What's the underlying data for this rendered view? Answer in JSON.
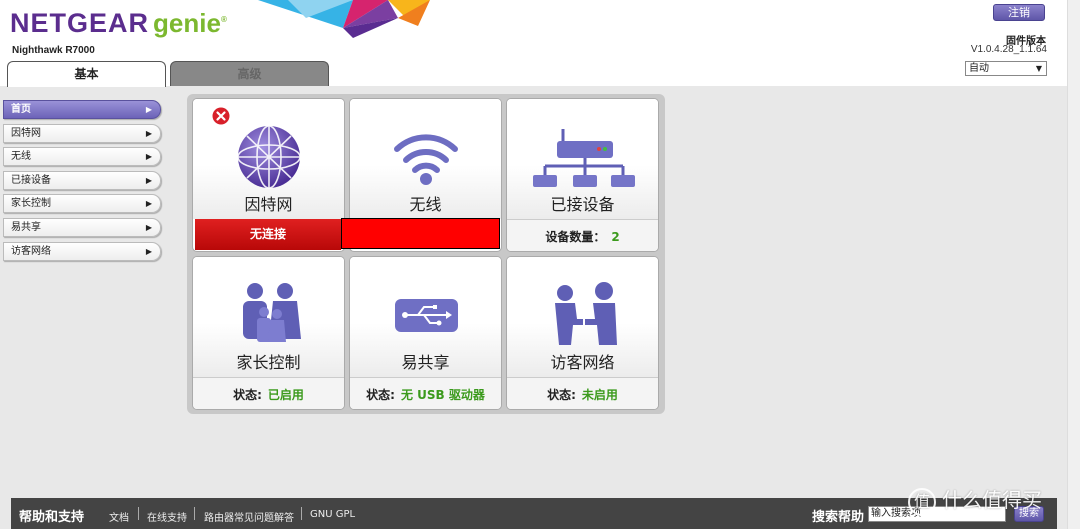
{
  "header": {
    "logo_brand": "NETGEAR",
    "logo_product": "genie",
    "logo_trademark": "®",
    "model": "Nighthawk R7000",
    "logout_label": "注销",
    "firmware_label": "固件版本",
    "firmware_version": "V1.0.4.28_1.1.64",
    "language_selected": "自动"
  },
  "tabs": [
    {
      "label": "基本",
      "active": true
    },
    {
      "label": "高级",
      "active": false
    }
  ],
  "sidebar": {
    "items": [
      {
        "label": "首页",
        "active": true
      },
      {
        "label": "因特网"
      },
      {
        "label": "无线"
      },
      {
        "label": "已接设备"
      },
      {
        "label": "家长控制"
      },
      {
        "label": "易共享"
      },
      {
        "label": "访客网络"
      }
    ],
    "arrow_glyph": "▶"
  },
  "tiles": {
    "internet": {
      "name": "因特网",
      "status": "无连接"
    },
    "wireless": {
      "name": "无线"
    },
    "devices": {
      "name": "已接设备",
      "status_label": "设备数量：",
      "status_value": "2"
    },
    "parental": {
      "name": "家长控制",
      "status_label": "状态:",
      "status_value": "已启用"
    },
    "readyshare": {
      "name": "易共享",
      "status_label": "状态:",
      "status_value": "无 USB 驱动器"
    },
    "guest": {
      "name": "访客网络",
      "status_label": "状态:",
      "status_value": "未启用"
    }
  },
  "footer": {
    "help_title": "帮助和支持",
    "links": [
      "文档",
      "在线支持",
      "路由器常见问题解答",
      "GNU GPL"
    ],
    "search_label": "搜索帮助",
    "search_placeholder": "输入搜索项",
    "search_button": "搜索"
  },
  "watermark": {
    "circle_glyph": "值",
    "text": "什么值得买"
  },
  "colors": {
    "brand_purple": "#5b2d8e",
    "genie_green": "#7cb82f",
    "status_green": "#3b9a1c",
    "alert_red": "#ff0000",
    "icon_purple": "#5f5fb5"
  }
}
